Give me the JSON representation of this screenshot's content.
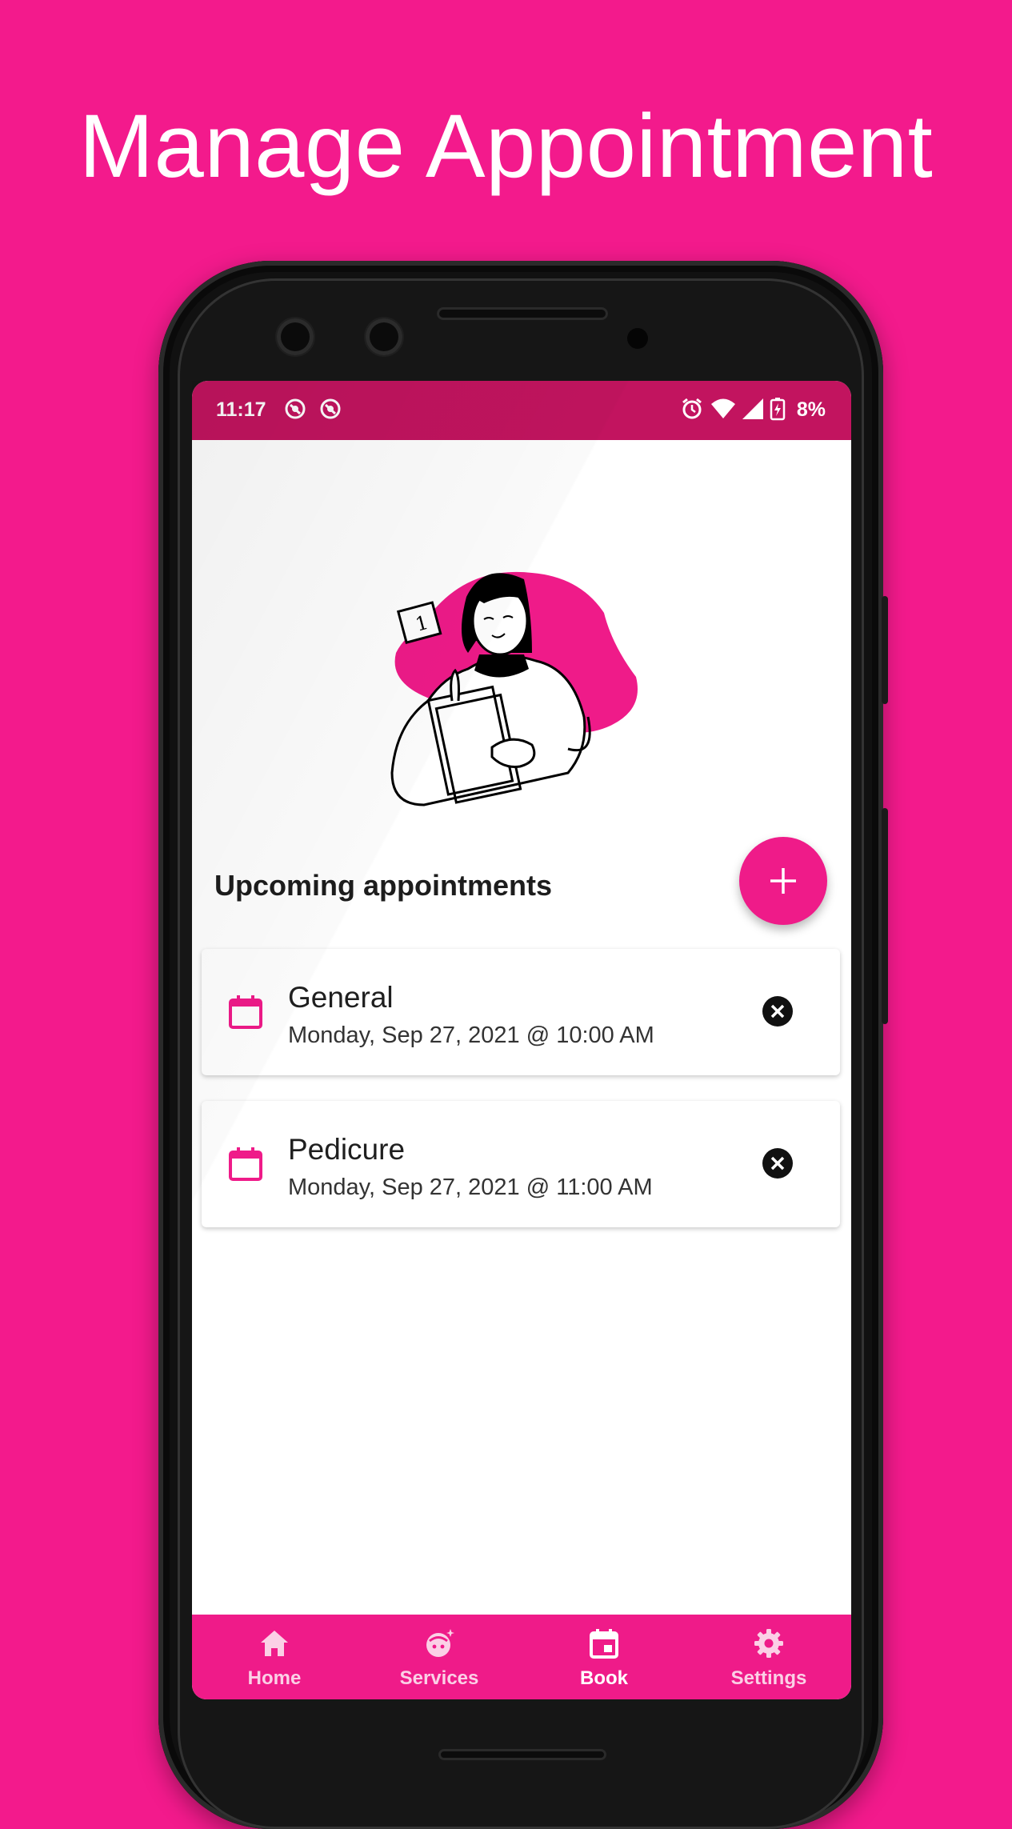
{
  "headline": "Manage Appointment",
  "status_bar": {
    "time": "11:17",
    "battery": "8%",
    "icons": [
      "app-notification-icon",
      "app-notification-icon",
      "alarm-icon",
      "wifi-icon",
      "signal-icon",
      "battery-charging-icon"
    ]
  },
  "colors": {
    "brand_pink": "#ef1b89",
    "status_bar": "#c2145f",
    "background": "#f31a8c"
  },
  "main": {
    "section_title": "Upcoming appointments",
    "fab_icon": "plus-icon",
    "appointments": [
      {
        "title": "General",
        "datetime": "Monday, Sep 27, 2021 @ 10:00 AM"
      },
      {
        "title": "Pedicure",
        "datetime": "Monday, Sep 27, 2021 @ 11:00 AM"
      }
    ]
  },
  "bottom_nav": {
    "items": [
      {
        "label": "Home",
        "icon": "home-icon"
      },
      {
        "label": "Services",
        "icon": "face-sparkle-icon"
      },
      {
        "label": "Book",
        "icon": "calendar-icon",
        "active": true
      },
      {
        "label": "Settings",
        "icon": "gear-icon"
      }
    ]
  }
}
